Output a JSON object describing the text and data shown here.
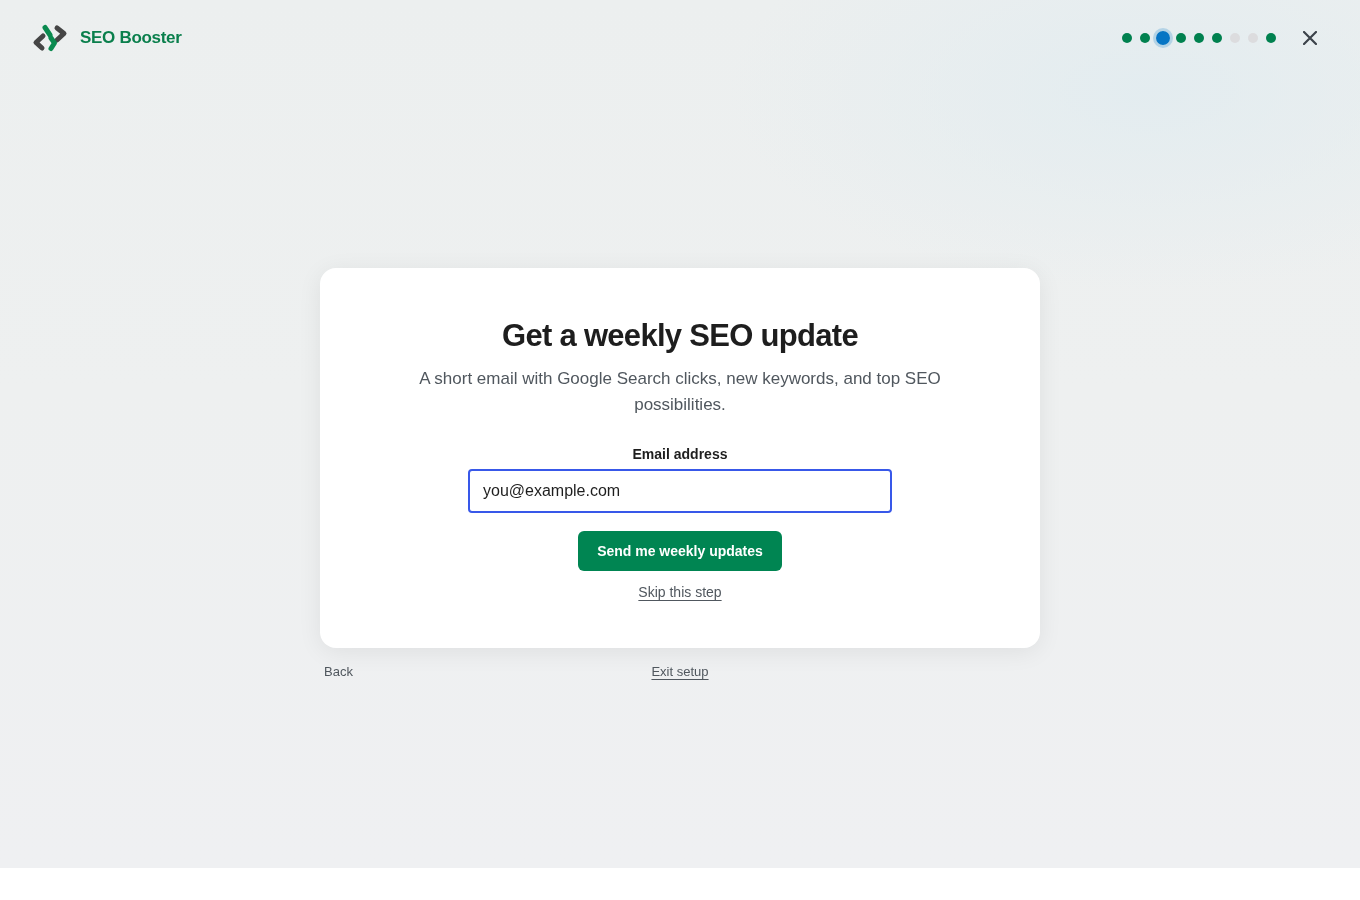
{
  "header": {
    "brand": "SEO Booster",
    "steps": [
      {
        "selected": false,
        "completed": true
      },
      {
        "selected": false,
        "completed": true
      },
      {
        "selected": true,
        "completed": false
      },
      {
        "selected": false,
        "completed": true
      },
      {
        "selected": false,
        "completed": true
      },
      {
        "selected": false,
        "completed": true
      },
      {
        "selected": false,
        "completed": false
      },
      {
        "selected": false,
        "completed": false
      },
      {
        "selected": false,
        "completed": true
      }
    ]
  },
  "card": {
    "title": "Get a weekly SEO update",
    "description": "A short email with Google Search clicks, new keywords, and top SEO possibilities.",
    "email": {
      "label": "Email address",
      "value": "you@example.com",
      "focused": true
    },
    "submit_button": "Send me weekly updates",
    "skip_link": "Skip this step"
  },
  "footer": {
    "back_link": "Back",
    "exit_link": "Exit setup"
  }
}
